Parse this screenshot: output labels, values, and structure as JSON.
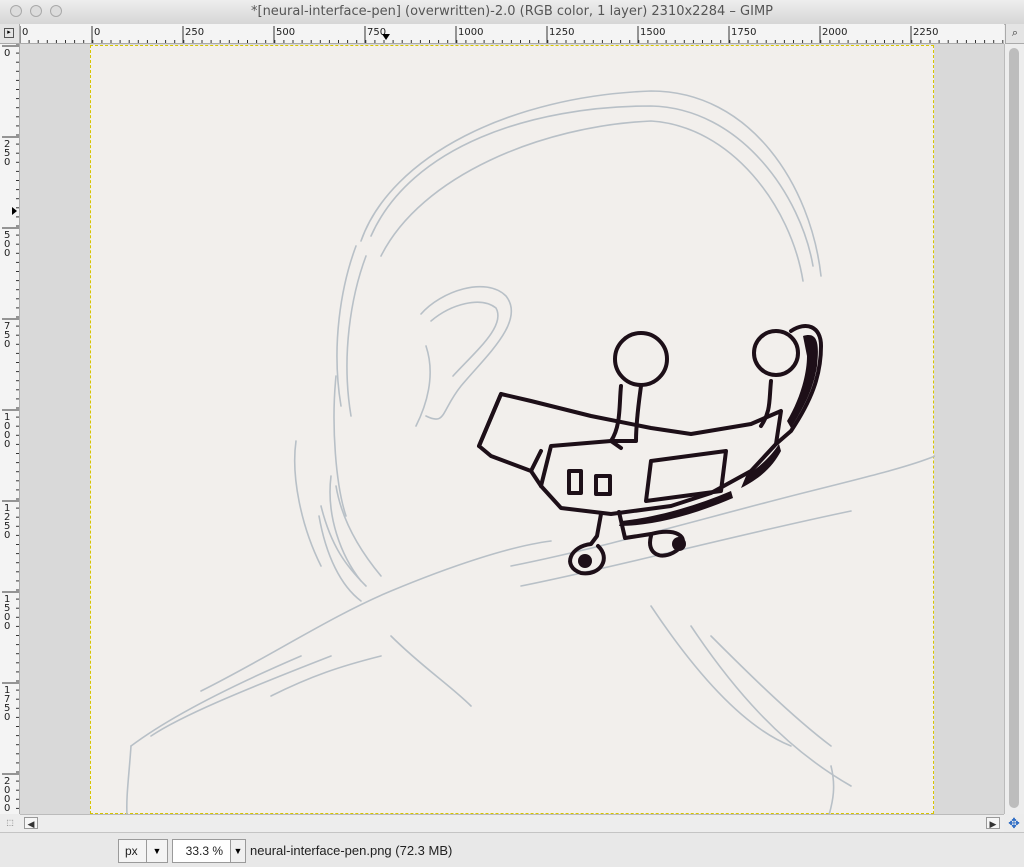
{
  "window": {
    "title": "*[neural-interface-pen] (overwritten)-2.0 (RGB color, 1 layer) 2310x2284 – GIMP"
  },
  "rulers": {
    "horizontal_labels": [
      "0",
      "0",
      "250",
      "500",
      "750",
      "1000",
      "1250",
      "1500",
      "1750",
      "2000",
      "2250"
    ],
    "vertical_labels": [
      "0",
      "250",
      "500",
      "750",
      "1000",
      "1250",
      "1500",
      "1750",
      "2000"
    ]
  },
  "status": {
    "unit": "px",
    "zoom": "33.3 %",
    "file_info": "neural-interface-pen.png (72.3 MB)"
  },
  "icons": {
    "nav": "navigate-icon",
    "move": "move-arrows-icon",
    "quickmask": "quick-mask-icon"
  },
  "colors": {
    "canvas_bg": "#f2efec",
    "pencil": "#b9c0c6",
    "ink": "#1d0f18"
  }
}
